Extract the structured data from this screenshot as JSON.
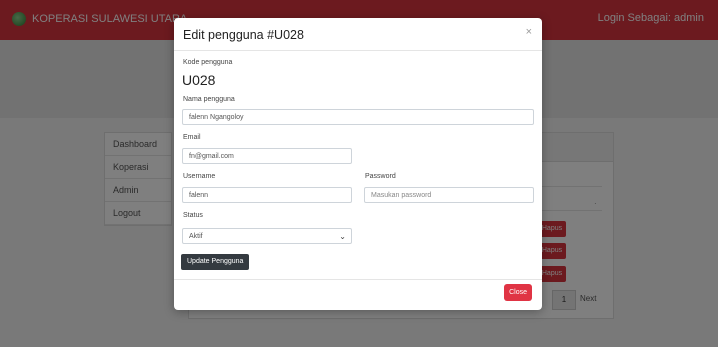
{
  "app": {
    "brand": "KOPERASI SULAWESI UTARA",
    "login_as": "Login Sebagai: admin"
  },
  "sidebar": {
    "items": [
      {
        "label": "Dashboard"
      },
      {
        "label": "Koperasi"
      },
      {
        "label": "Admin"
      },
      {
        "label": "Logout"
      }
    ]
  },
  "table_bg": {
    "delete_label": "Hapus",
    "pagination": {
      "current": "1",
      "next": "Next"
    }
  },
  "modal": {
    "title": "Edit pengguna #U028",
    "close_icon": "×",
    "kode_label": "Kode pengguna",
    "kode_value": "U028",
    "nama_label": "Nama pengguna",
    "nama_value": "falenn Ngangoloy",
    "email_label": "Email",
    "email_value": "fn@gmail.com",
    "username_label": "Username",
    "username_value": "falenn",
    "password_label": "Password",
    "password_placeholder": "Masukan password",
    "status_label": "Status",
    "status_value": "Aktif",
    "update_button": "Update Pengguna",
    "close_button": "Close"
  },
  "colors": {
    "primary_red": "#d9353f",
    "close_red": "#e03444",
    "dark_button": "#343a40"
  }
}
